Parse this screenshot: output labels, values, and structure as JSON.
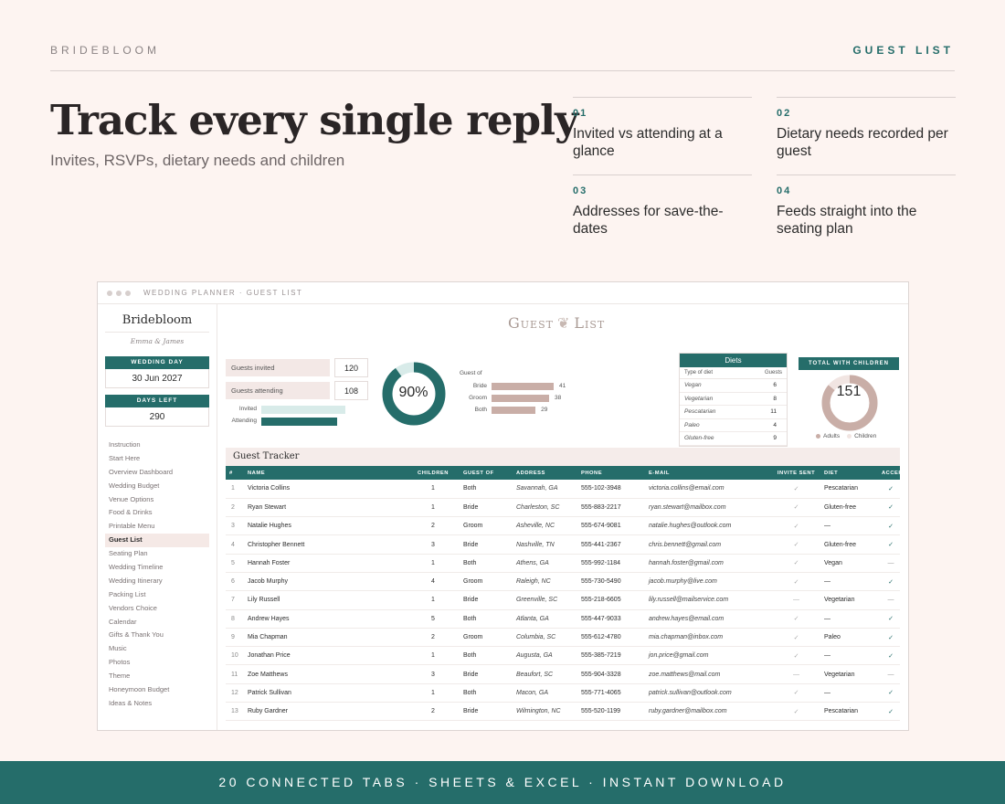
{
  "header": {
    "brand": "BRIDEBLOOM",
    "section": "GUEST LIST"
  },
  "hero": {
    "title": "Track every single reply",
    "subtitle": "Invites, RSVPs, dietary needs and children"
  },
  "features": [
    {
      "num": "01",
      "text": "Invited vs attending at a glance"
    },
    {
      "num": "02",
      "text": "Dietary needs recorded per guest"
    },
    {
      "num": "03",
      "text": "Addresses for save-the-dates"
    },
    {
      "num": "04",
      "text": "Feeds straight into the seating plan"
    }
  ],
  "window": {
    "title": "WEDDING PLANNER · GUEST LIST"
  },
  "sidebar": {
    "brand": "Bridebloom",
    "couple": "Emma & James",
    "wedding_day_label": "WEDDING DAY",
    "wedding_day": "30 Jun 2027",
    "days_left_label": "DAYS LEFT",
    "days_left": "290",
    "nav": [
      "Instruction",
      "Start Here",
      "Overview Dashboard",
      "Wedding Budget",
      "Venue Options",
      "Food & Drinks",
      "Printable Menu",
      "Guest List",
      "Seating Plan",
      "Wedding Timeline",
      "Wedding Itinerary",
      "Packing List",
      "Vendors Choice",
      "Calendar",
      "Gifts & Thank You",
      "Music",
      "Photos",
      "Theme",
      "Honeymoon Budget",
      "Ideas & Notes"
    ],
    "active": "Guest List"
  },
  "sheet_title": {
    "left": "Guest",
    "right": "List"
  },
  "stats": {
    "invited_label": "Guests invited",
    "invited": 120,
    "attending_label": "Guests attending",
    "attending": 108,
    "mini_invited_label": "Invited",
    "mini_attending_label": "Attending",
    "attending_pct": 0.9,
    "pct_text": "90%"
  },
  "guest_of": {
    "label": "Guest of",
    "rows": [
      {
        "name": "Bride",
        "value": 41
      },
      {
        "name": "Groom",
        "value": 38
      },
      {
        "name": "Both",
        "value": 29
      }
    ]
  },
  "diets": {
    "title": "Diets",
    "col1": "Type of diet",
    "col2": "Guests",
    "rows": [
      {
        "type": "Vegan",
        "n": "6"
      },
      {
        "type": "Vegetarian",
        "n": "8"
      },
      {
        "type": "Pescatarian",
        "n": "11"
      },
      {
        "type": "Paleo",
        "n": "4"
      },
      {
        "type": "Gluten-free",
        "n": "9"
      }
    ]
  },
  "total_children": {
    "label": "TOTAL WITH CHILDREN",
    "value": "151",
    "adults_label": "Adults",
    "children_label": "Children",
    "adults_fraction": 0.86
  },
  "colors": {
    "teal": "#256d6a",
    "rose": "#c9aea7",
    "pale_teal": "#d8ebe9",
    "pale_rose": "#f1e5e2"
  },
  "tracker": {
    "title": "Guest Tracker",
    "columns": [
      "#",
      "NAME",
      "CHILDREN",
      "GUEST OF",
      "ADDRESS",
      "PHONE",
      "E-MAIL",
      "INVITE SENT",
      "DIET",
      "ACCEPT"
    ],
    "rows": [
      [
        "1",
        "Victoria Collins",
        "1",
        "Both",
        "Savannah, GA",
        "555-102-3948",
        "victoria.collins@email.com",
        "✓",
        "Pescatarian",
        "✓"
      ],
      [
        "2",
        "Ryan Stewart",
        "1",
        "Bride",
        "Charleston, SC",
        "555-883-2217",
        "ryan.stewart@mailbox.com",
        "✓",
        "Gluten-free",
        "✓"
      ],
      [
        "3",
        "Natalie Hughes",
        "2",
        "Groom",
        "Asheville, NC",
        "555-674-9081",
        "natalie.hughes@outlook.com",
        "✓",
        "—",
        "✓"
      ],
      [
        "4",
        "Christopher Bennett",
        "3",
        "Bride",
        "Nashville, TN",
        "555-441-2367",
        "chris.bennett@gmail.com",
        "✓",
        "Gluten-free",
        "✓"
      ],
      [
        "5",
        "Hannah Foster",
        "1",
        "Both",
        "Athens, GA",
        "555-992-1184",
        "hannah.foster@gmail.com",
        "✓",
        "Vegan",
        "—"
      ],
      [
        "6",
        "Jacob Murphy",
        "4",
        "Groom",
        "Raleigh, NC",
        "555-730-5490",
        "jacob.murphy@live.com",
        "✓",
        "—",
        "✓"
      ],
      [
        "7",
        "Lily Russell",
        "1",
        "Bride",
        "Greenville, SC",
        "555-218-6605",
        "lily.russell@mailservice.com",
        "—",
        "Vegetarian",
        "—"
      ],
      [
        "8",
        "Andrew Hayes",
        "5",
        "Both",
        "Atlanta, GA",
        "555-447-9033",
        "andrew.hayes@email.com",
        "✓",
        "—",
        "✓"
      ],
      [
        "9",
        "Mia Chapman",
        "2",
        "Groom",
        "Columbia, SC",
        "555-612-4780",
        "mia.chapman@inbox.com",
        "✓",
        "Paleo",
        "✓"
      ],
      [
        "10",
        "Jonathan Price",
        "1",
        "Both",
        "Augusta, GA",
        "555-385-7219",
        "jon.price@gmail.com",
        "✓",
        "—",
        "✓"
      ],
      [
        "11",
        "Zoe Matthews",
        "3",
        "Bride",
        "Beaufort, SC",
        "555-904-3328",
        "zoe.matthews@mail.com",
        "—",
        "Vegetarian",
        "—"
      ],
      [
        "12",
        "Patrick Sullivan",
        "1",
        "Both",
        "Macon, GA",
        "555-771-4065",
        "patrick.sullivan@outlook.com",
        "✓",
        "—",
        "✓"
      ],
      [
        "13",
        "Ruby Gardner",
        "2",
        "Bride",
        "Wilmington, NC",
        "555-520-1199",
        "ruby.gardner@mailbox.com",
        "✓",
        "Pescatarian",
        "✓"
      ]
    ]
  },
  "footer": "20 CONNECTED TABS · SHEETS & EXCEL · INSTANT DOWNLOAD"
}
